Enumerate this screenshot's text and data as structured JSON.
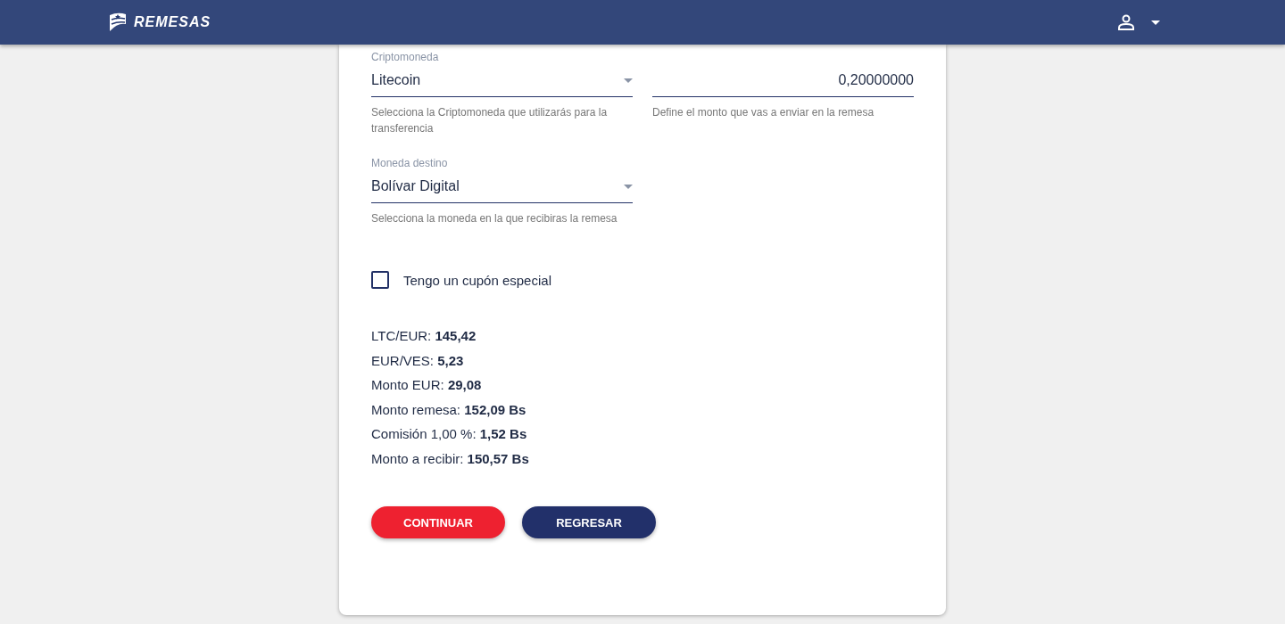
{
  "header": {
    "brand": "REMESAS"
  },
  "fields": [
    {
      "kind": "select",
      "label": "Criptomoneda",
      "value": "Litecoin",
      "helper": "Selecciona la Criptomoneda que utilizarás para la transferencia"
    },
    {
      "kind": "number",
      "value": "0,20000000",
      "helper": "Define el monto que vas a enviar en la remesa"
    },
    {
      "kind": "select",
      "label": "Moneda destino",
      "value": "Bolívar Digital",
      "helper": "Selecciona la moneda en la que recibiras la remesa"
    }
  ],
  "coupon": {
    "label": "Tengo un cupón especial",
    "checked": false
  },
  "summary": [
    "LTC/EUR: **145,42**",
    "EUR/VES: **5,23**",
    "Monto EUR: **29,08**",
    "Monto remesa: **152,09 Bs**",
    "Comisión 1,00 %: **1,52 Bs**",
    "Monto a recibir: **150,57 Bs**"
  ],
  "buttons": [
    {
      "label": "CONTINUAR",
      "kind": "primary"
    },
    {
      "label": "REGRESAR",
      "kind": "secondary"
    }
  ]
}
